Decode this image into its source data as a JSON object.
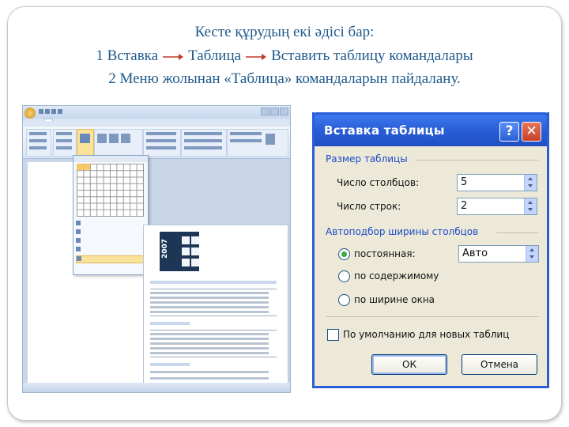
{
  "slide": {
    "line1": "Кесте құрудың екі әдісі бар:",
    "line2_part1": "1 Вставка",
    "line2_part2": "Таблица",
    "line2_part3": "Вставить таблицу командалары",
    "line3": "2 Меню жолынан «Таблица» командаларын пайдалану.",
    "text_color": "#1f5a8c",
    "arrow_color": "#c0392b"
  },
  "word_screenshot": {
    "calendar_year": "2007"
  },
  "dialog": {
    "title": "Вставка таблицы",
    "help_icon": "help-icon",
    "close_icon": "close-icon",
    "size_group": "Размер таблицы",
    "columns_label": "Число столбцов:",
    "columns_value": "5",
    "rows_label": "Число строк:",
    "rows_value": "2",
    "autofit_group": "Автоподбор ширины столбцов",
    "fixed_label": "постоянная:",
    "fixed_value": "Авто",
    "content_label": "по содержимому",
    "window_label": "по ширине окна",
    "default_label": "По умолчанию для новых таблиц",
    "ok_label": "ОК",
    "cancel_label": "Отмена",
    "selected_autofit": "постоянная",
    "titlebar_color": "#2a5fd8",
    "group_color": "#1c49c8"
  }
}
